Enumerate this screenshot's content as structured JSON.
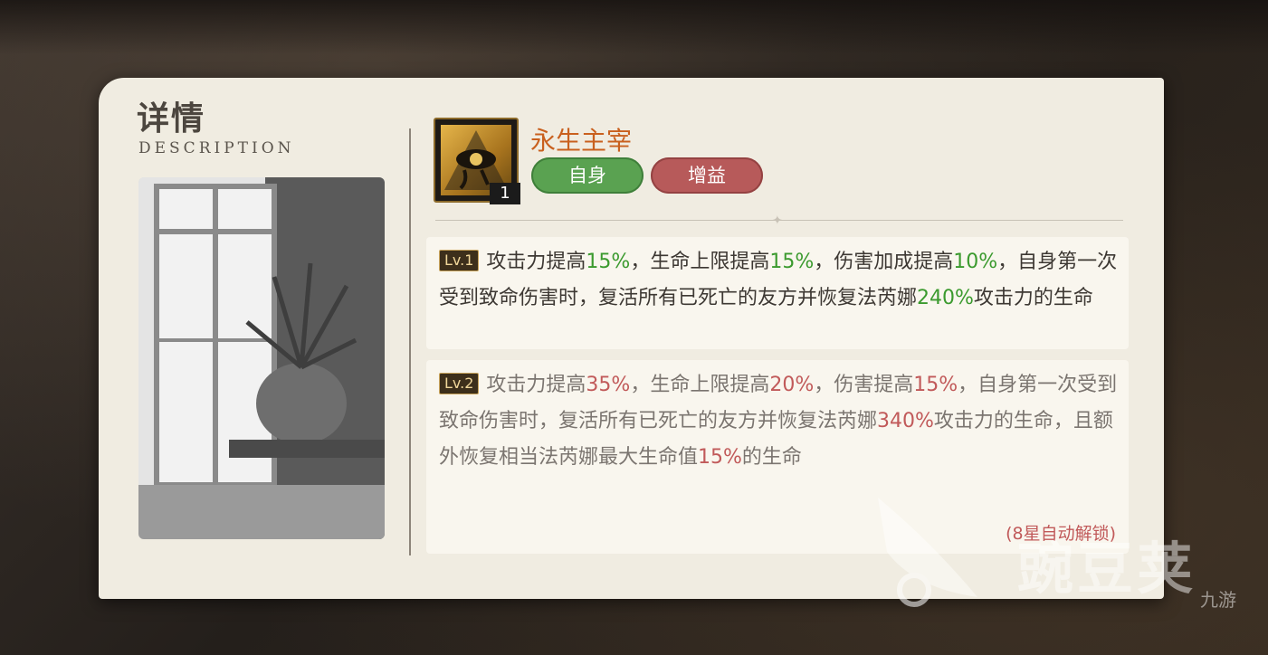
{
  "panel": {
    "title_cn": "详情",
    "title_en": "DESCRIPTION"
  },
  "skill": {
    "name": "永生主宰",
    "level_badge": "1",
    "icon": "eye-of-horus-icon",
    "tags": [
      {
        "label": "自身",
        "color": "#5aa251"
      },
      {
        "label": "增益",
        "color": "#b75a5a"
      }
    ]
  },
  "levels": [
    {
      "badge": "Lv.1",
      "segments": [
        {
          "t": "攻击力提高"
        },
        {
          "t": "15%",
          "c": "green"
        },
        {
          "t": "，生命上限提高"
        },
        {
          "t": "15%",
          "c": "green"
        },
        {
          "t": "，伤害加成提高"
        },
        {
          "t": "10%",
          "c": "green"
        },
        {
          "t": "，自身第一次受到致命伤害时，复活所有已死亡的友方并恢复法芮娜"
        },
        {
          "t": "240%",
          "c": "green"
        },
        {
          "t": "攻击力的生命"
        }
      ]
    },
    {
      "badge": "Lv.2",
      "segments": [
        {
          "t": "攻击力提高"
        },
        {
          "t": "35%",
          "c": "red"
        },
        {
          "t": "，生命上限提高"
        },
        {
          "t": "20%",
          "c": "red"
        },
        {
          "t": "，伤害提高"
        },
        {
          "t": "15%",
          "c": "red"
        },
        {
          "t": "，自身第一次受到致命伤害时，复活所有已死亡的友方并恢复法芮娜"
        },
        {
          "t": "340%",
          "c": "red"
        },
        {
          "t": "攻击力的生命，且额外恢复相当法芮娜最大生命值"
        },
        {
          "t": "15%",
          "c": "red"
        },
        {
          "t": "的生命"
        }
      ],
      "unlock_note": "(8星自动解锁)"
    }
  ],
  "watermark": {
    "text": "豌豆荚",
    "sub": "九游"
  },
  "colors": {
    "panel_bg": "#f0ece1",
    "skill_name": "#c9601e",
    "highlight_green": "#3b9a2e",
    "highlight_red": "#c15a5a"
  }
}
